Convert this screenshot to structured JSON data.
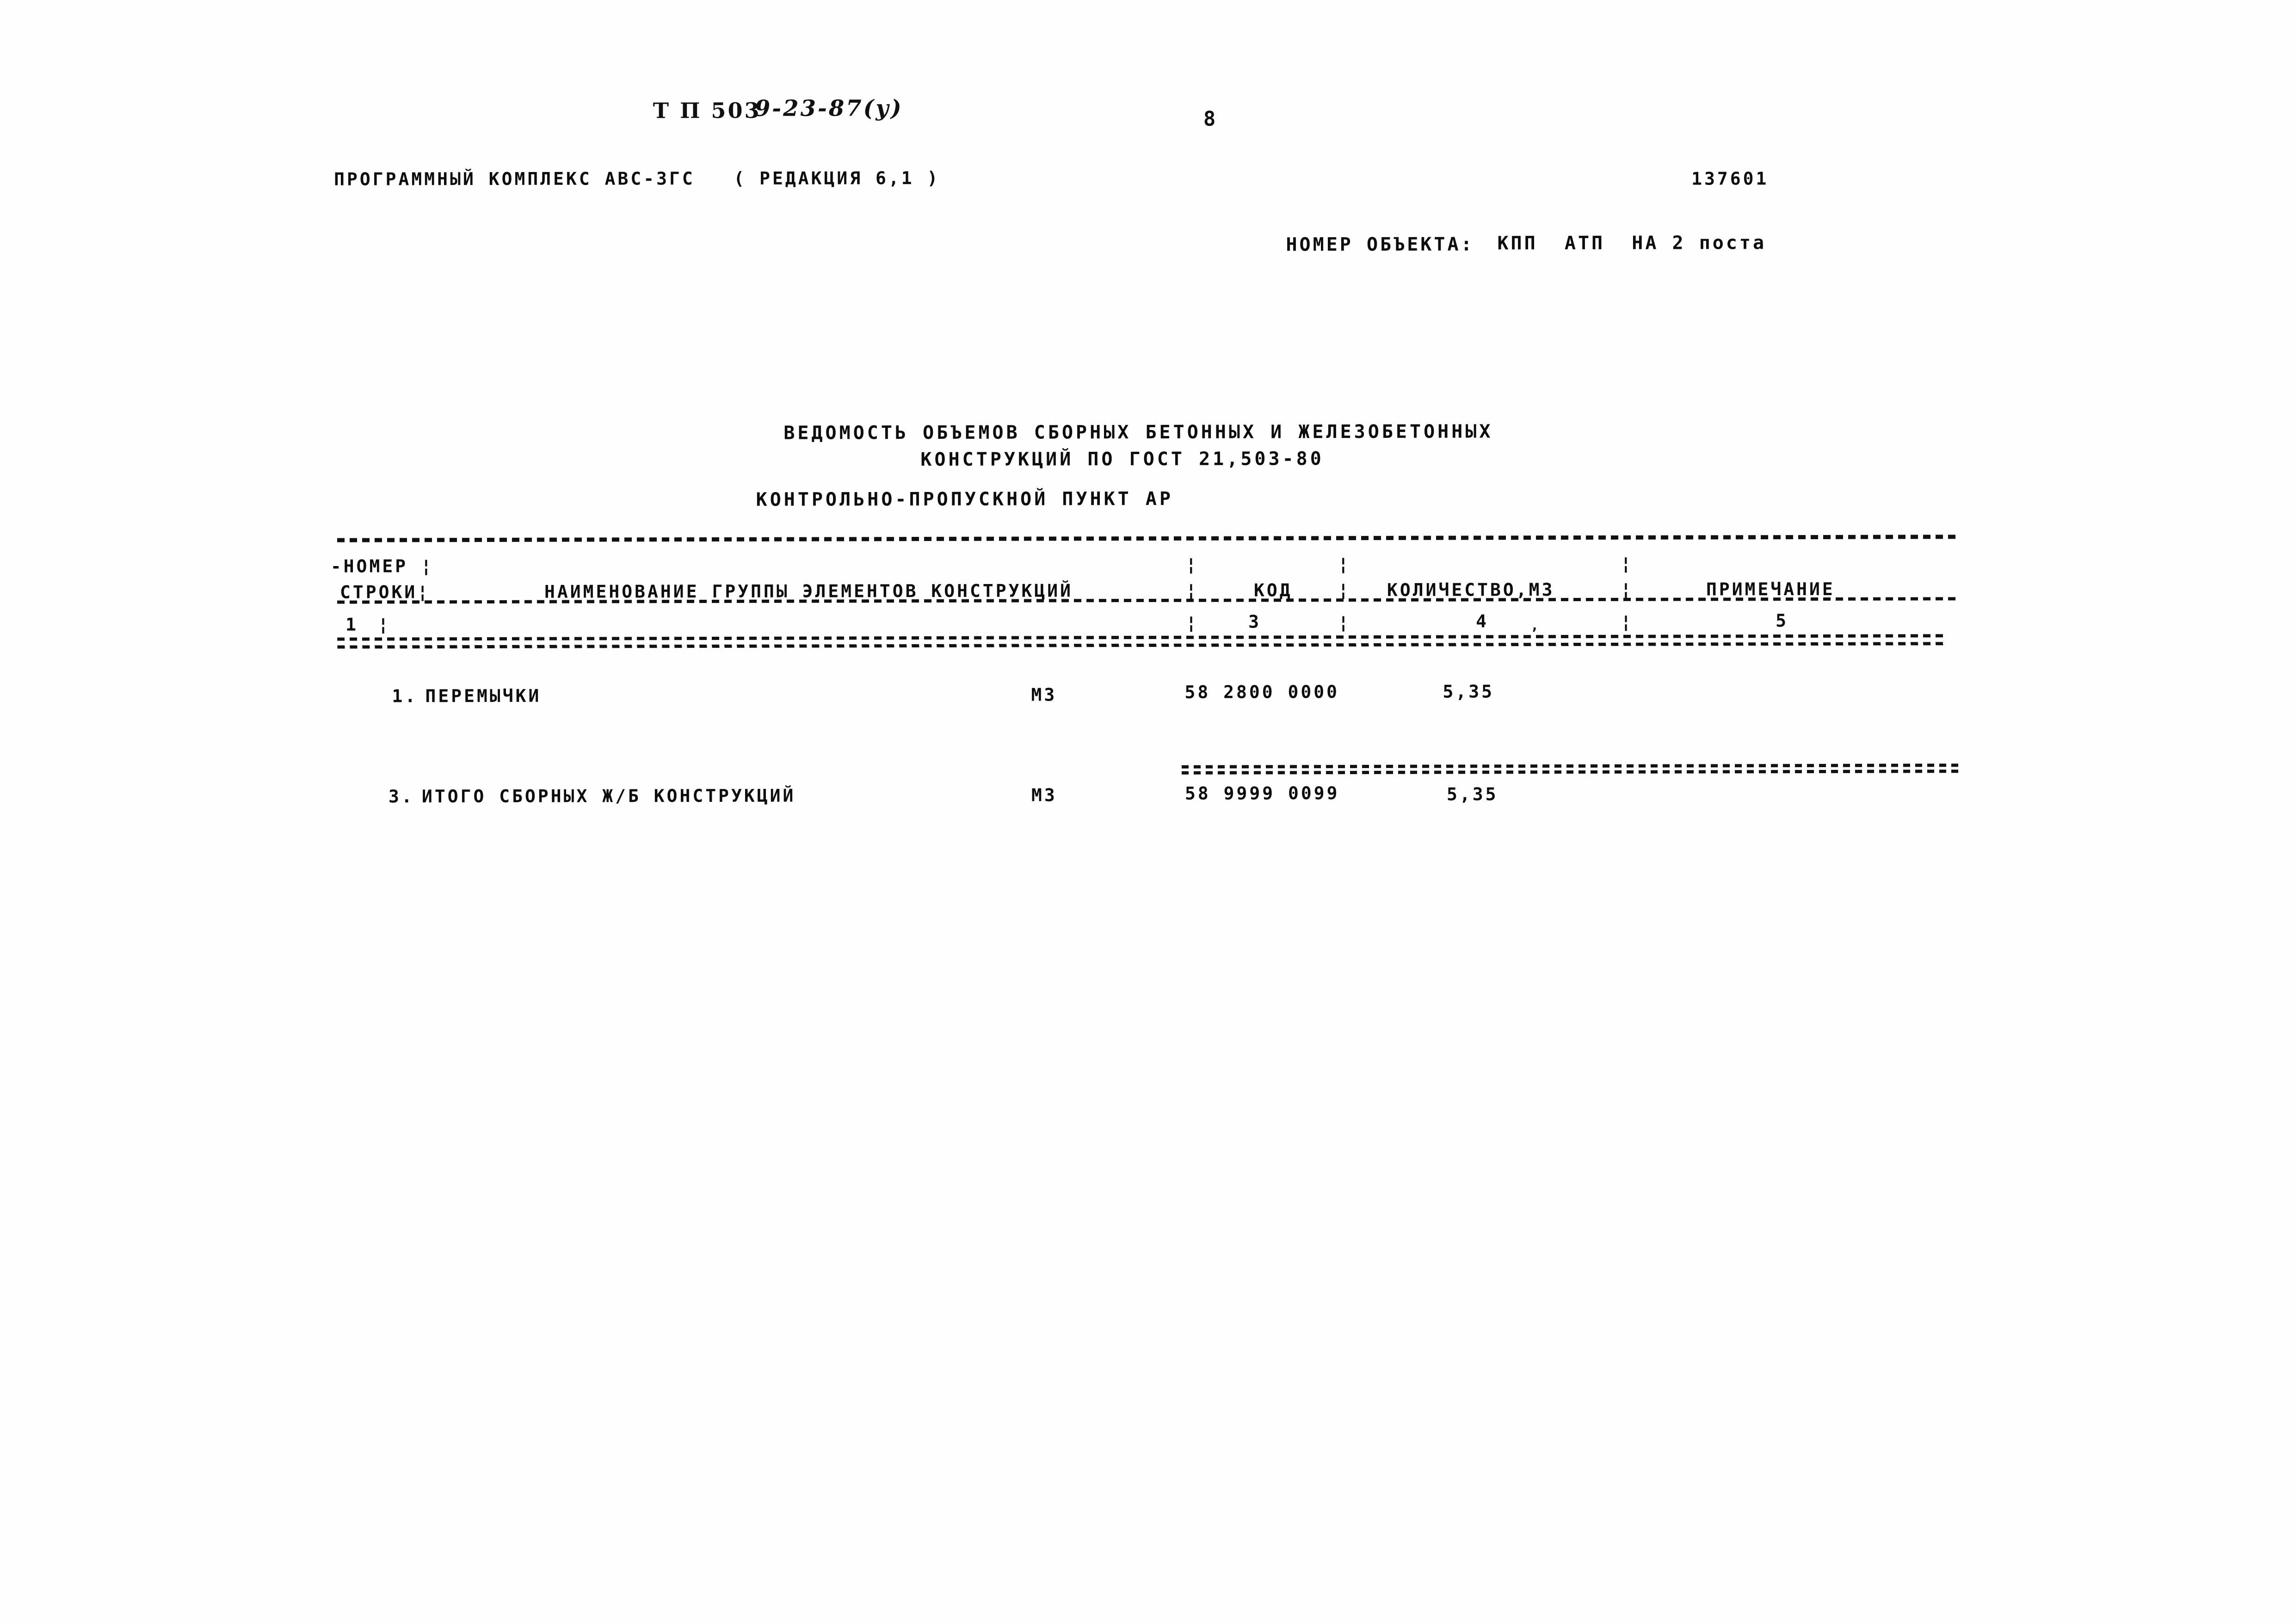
{
  "document": {
    "annotation_code": "Т П 503",
    "annotation_code_suffix": "9-23-87(у)",
    "page_number": "8",
    "software_line": "ПРОГРАММНЫЙ КОМПЛЕКС АВС-ЗГС   ( РЕДАКЦИЯ 6,1 )",
    "doc_number": "137601",
    "object_label": "НОМЕР ОБЪЕКТА:",
    "object_name": "КПП  АТП  НА 2 поста",
    "title_line1": "ВЕДОМОСТЬ ОБЪЕМОВ СБОРНЫХ БЕТОННЫХ И ЖЕЛЕЗОБЕТОННЫХ",
    "title_line2": "КОНСТРУКЦИЙ ПО ГОСТ 21,503-80",
    "subtitle": "КОНТРОЛЬНО-ПРОПУСКНОЙ ПУНКТ АР"
  },
  "table": {
    "header": {
      "col1_line1": "-НОМЕР ¦",
      "col1_line2": "СТРОКИ¦",
      "col2": "НАИМЕНОВАНИЕ ГРУППЫ ЭЛЕМЕНТОВ КОНСТРУКЦИЙ",
      "col3": "КОД",
      "col4": "КОЛИЧЕСТВО,М3",
      "col5": "ПРИМЕЧАНИЕ",
      "sep1": "¦",
      "sep2": "¦",
      "sep3": "¦",
      "sep4": "¦"
    },
    "column_numbers": {
      "n1": "1",
      "n1_sep": "¦",
      "n3": "3",
      "n4": "4",
      "n5": "5",
      "s1": "¦",
      "s2": "¦",
      "s3": "¦",
      "s4": "¦",
      "dot": ","
    },
    "rows": [
      {
        "line_no": "1.",
        "name": "ПЕРЕМЫЧКИ",
        "unit": "М3",
        "code": "58 2800 0000",
        "quantity": "5,35",
        "note": ""
      },
      {
        "line_no": "3.",
        "name": "ИТОГО СБОРНЫХ Ж/Б КОНСТРУКЦИЙ",
        "unit": "М3",
        "code": "58 9999 0099",
        "quantity": "5,35",
        "note": ""
      }
    ]
  },
  "colors": {
    "ink": "#111111",
    "paper": "#ffffff"
  }
}
